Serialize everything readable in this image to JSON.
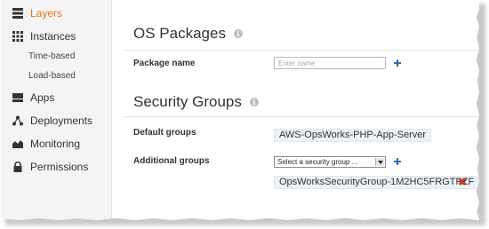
{
  "sidebar": {
    "items": [
      {
        "label": "Layers",
        "icon": "layers-icon",
        "active": true
      },
      {
        "label": "Instances",
        "icon": "grid-icon",
        "active": false
      },
      {
        "label": "Apps",
        "icon": "apps-icon",
        "active": false
      },
      {
        "label": "Deployments",
        "icon": "deployments-icon",
        "active": false
      },
      {
        "label": "Monitoring",
        "icon": "monitoring-icon",
        "active": false
      },
      {
        "label": "Permissions",
        "icon": "lock-icon",
        "active": false
      }
    ],
    "instance_subitems": [
      "Time-based",
      "Load-based"
    ]
  },
  "os_packages": {
    "title": "OS Packages",
    "package_name_label": "Package name",
    "package_name_placeholder": "Enter name"
  },
  "security_groups": {
    "title": "Security Groups",
    "default_groups_label": "Default groups",
    "default_group": "AWS-OpsWorks-PHP-App-Server",
    "additional_groups_label": "Additional groups",
    "select_placeholder": "Select a security group ...",
    "additional_group": "OpsWorksSecurityGroup-1M2HC5FRGTPZF"
  },
  "colors": {
    "accent": "#e47911",
    "link_blue": "#2c6fb6",
    "remove_red": "#c0392b",
    "tag_bg": "#ecf1f7"
  }
}
